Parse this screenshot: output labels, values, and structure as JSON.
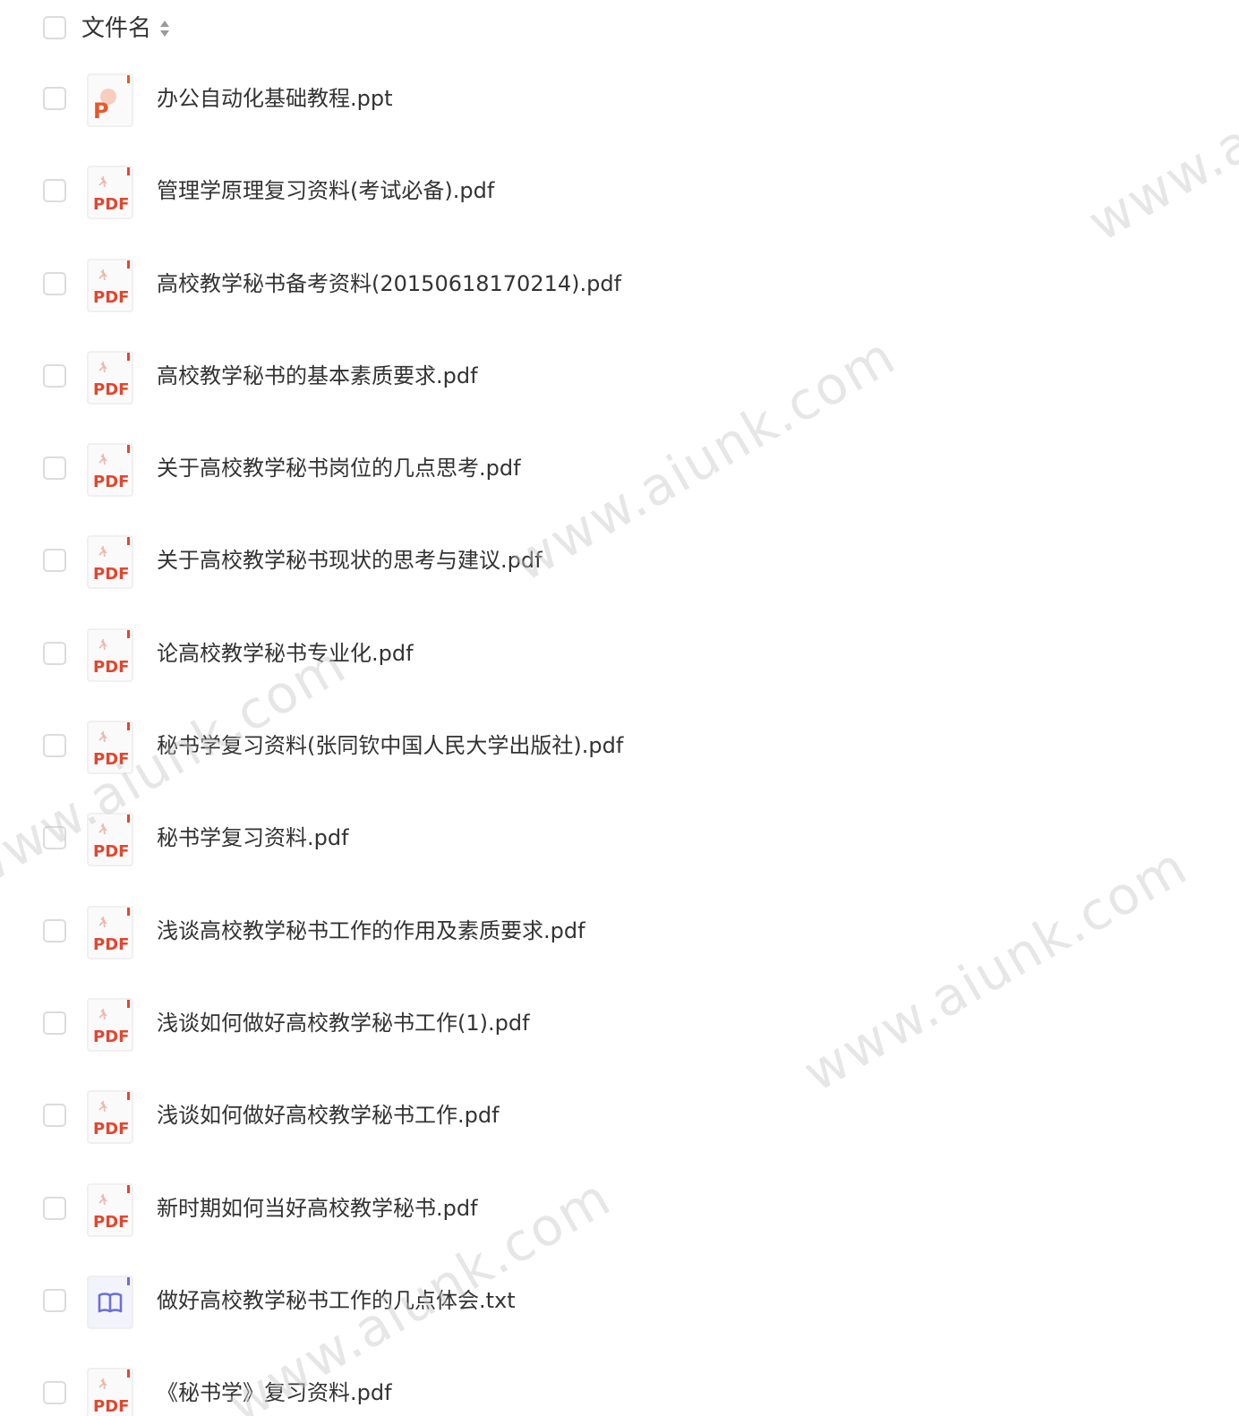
{
  "header": {
    "column_label": "文件名"
  },
  "files": [
    {
      "name": "办公自动化基础教程.ppt",
      "type": "ppt"
    },
    {
      "name": "管理学原理复习资料(考试必备).pdf",
      "type": "pdf"
    },
    {
      "name": "高校教学秘书备考资料(20150618170214).pdf",
      "type": "pdf"
    },
    {
      "name": "高校教学秘书的基本素质要求.pdf",
      "type": "pdf"
    },
    {
      "name": "关于高校教学秘书岗位的几点思考.pdf",
      "type": "pdf"
    },
    {
      "name": "关于高校教学秘书现状的思考与建议.pdf",
      "type": "pdf"
    },
    {
      "name": "论高校教学秘书专业化.pdf",
      "type": "pdf"
    },
    {
      "name": "秘书学复习资料(张同钦中国人民大学出版社).pdf",
      "type": "pdf"
    },
    {
      "name": "秘书学复习资料.pdf",
      "type": "pdf"
    },
    {
      "name": "浅谈高校教学秘书工作的作用及素质要求.pdf",
      "type": "pdf"
    },
    {
      "name": "浅谈如何做好高校教学秘书工作(1).pdf",
      "type": "pdf"
    },
    {
      "name": "浅谈如何做好高校教学秘书工作.pdf",
      "type": "pdf"
    },
    {
      "name": "新时期如何当好高校教学秘书.pdf",
      "type": "pdf"
    },
    {
      "name": "做好高校教学秘书工作的几点体会.txt",
      "type": "txt"
    },
    {
      "name": "《秘书学》复习资料.pdf",
      "type": "pdf"
    }
  ],
  "icon_labels": {
    "pdf": "PDF",
    "ppt": "P"
  },
  "watermark_text": "www.aiunk.com",
  "colors": {
    "pdf_red": "#e2462f",
    "ppt_orange": "#e8582a",
    "txt_blue": "#6b6fd8",
    "checkbox_border": "#dcdcdc"
  }
}
